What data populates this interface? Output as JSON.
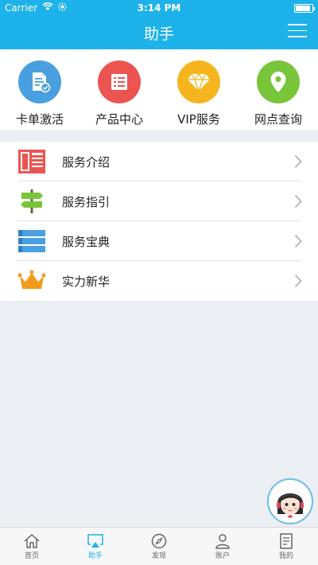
{
  "status_bar": {
    "carrier": "Carrier",
    "time": "3:14 PM",
    "battery_level": 0.9
  },
  "nav": {
    "title": "助手"
  },
  "quick_actions": [
    {
      "label": "卡单激活",
      "color": "#4a9fe0",
      "icon": "document-check-icon"
    },
    {
      "label": "产品中心",
      "color": "#ec5452",
      "icon": "list-icon"
    },
    {
      "label": "VIP服务",
      "color": "#f6b51e",
      "icon": "diamond-icon"
    },
    {
      "label": "网点查询",
      "color": "#79c53a",
      "icon": "location-pin-icon"
    }
  ],
  "list_items": [
    {
      "label": "服务介绍",
      "icon": "newspaper-icon"
    },
    {
      "label": "服务指引",
      "icon": "signpost-icon"
    },
    {
      "label": "服务宝典",
      "icon": "books-icon"
    },
    {
      "label": "实力新华",
      "icon": "crown-icon"
    }
  ],
  "tabs": [
    {
      "label": "首页",
      "icon": "home-icon",
      "active": false
    },
    {
      "label": "助手",
      "icon": "airplay-icon",
      "active": true
    },
    {
      "label": "发现",
      "icon": "compass-icon",
      "active": false
    },
    {
      "label": "账户",
      "icon": "user-icon",
      "active": false
    },
    {
      "label": "我的",
      "icon": "notes-icon",
      "active": false
    }
  ],
  "colors": {
    "brand": "#1db2e9",
    "background": "#ebeef2"
  }
}
